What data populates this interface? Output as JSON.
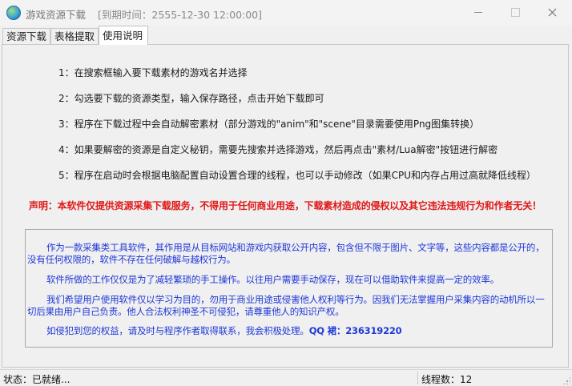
{
  "window": {
    "title": "游戏资源下载",
    "expiry": "[到期时间：2555-12-30 12:00:00]"
  },
  "tabs": [
    {
      "label": "资源下载"
    },
    {
      "label": "表格提取"
    },
    {
      "label": "使用说明"
    }
  ],
  "instructions": [
    "1：在搜索框输入要下载素材的游戏名并选择",
    "2：勾选要下载的资源类型，输入保存路径，点击开始下载即可",
    "3：程序在下载过程中会自动解密素材（部分游戏的\"anim\"和\"scene\"目录需要使用Png图集转换）",
    "4：如果要解密的资源是自定义秘钥，需要先搜索并选择游戏，然后再点击\"素材/Lua解密\"按钮进行解密",
    "5：程序在启动时会根据电脑配置自动设置合理的线程，也可以手动修改（如果CPU和内存占用过高就降低线程）"
  ],
  "disclaimer": "声明：本软件仅提供资源采集下载服务，不得用于任何商业用途，下载素材造成的侵权以及其它违法违规行为和作者无关！",
  "notice": {
    "p1": "作为一款采集类工具软件，其作用是从目标网站和游戏内获取公开内容，包含但不限于图片、文字等，这些内容都是公开的，没有任何权限的，软件不存在任何破解与越权行为。",
    "p2": "软件所做的工作仅仅是为了减轻繁琐的手工操作。以往用户需要手动保存，现在可以借助软件来提高一定的效率。",
    "p3": "我们希望用户使用软件仅以学习为目的，勿用于商业用途或侵害他人权利等行为。因我们无法掌握用户采集内容的动机所以一切后果由用户自己负责。他人合法权利神圣不可侵犯，请尊重他人的知识产权。",
    "p4": "如侵犯到您的权益，请及时与程序作者取得联系，我会积极处理。",
    "qq": "QQ 裙：236319220"
  },
  "status": {
    "left": "状态：已就绪...",
    "right": "线程数：12"
  },
  "colors": {
    "disclaimer": "#e01818",
    "notice_text": "#1f38d8",
    "background": "#f0f0f0"
  }
}
